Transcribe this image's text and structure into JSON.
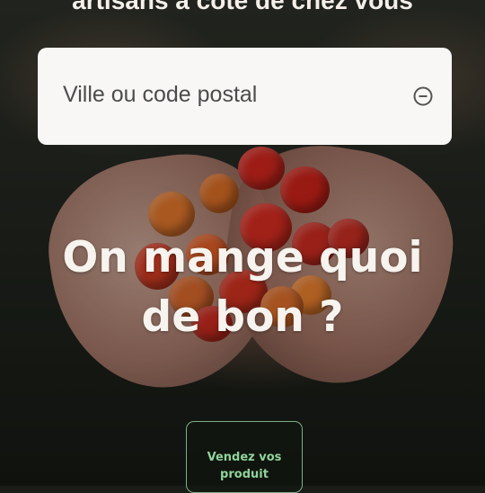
{
  "hero": {
    "title": "artisans à côté de chez vous"
  },
  "search": {
    "placeholder": "Ville ou code postal",
    "icon": "locate-icon"
  },
  "headline": {
    "line1": "On mange quoi",
    "line2": "de bon ?"
  },
  "cta": {
    "label_line1": "Vendez vos",
    "label_line2": "produit"
  },
  "colors": {
    "accent_green": "#8fd39a",
    "tomato_red": "#c8281f",
    "tomato_orange": "#d8642a"
  }
}
